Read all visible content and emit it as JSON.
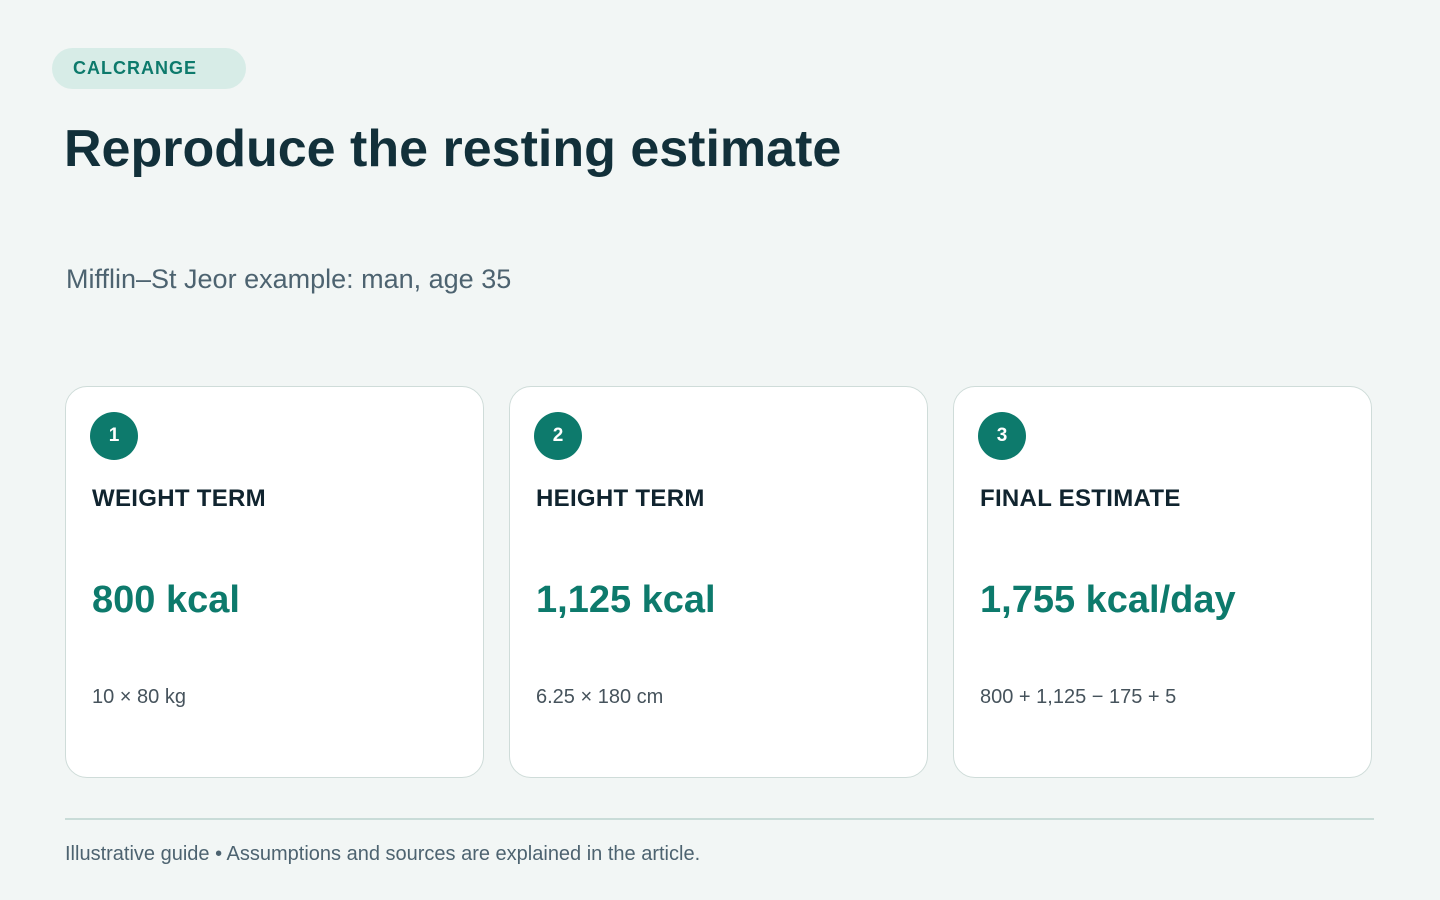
{
  "brand": {
    "label": "CALCRANGE"
  },
  "header": {
    "title": "Reproduce the resting estimate",
    "subtitle": "Mifflin–St Jeor example: man, age 35"
  },
  "cards": [
    {
      "step": "1",
      "label": "WEIGHT TERM",
      "value": "800 kcal",
      "formula": "10 × 80 kg"
    },
    {
      "step": "2",
      "label": "HEIGHT TERM",
      "value": "1,125 kcal",
      "formula": "6.25 × 180 cm"
    },
    {
      "step": "3",
      "label": "FINAL ESTIMATE",
      "value": "1,755 kcal/day",
      "formula": "800 + 1,125 − 175 + 5"
    }
  ],
  "footer": {
    "note": "Illustrative guide • Assumptions and sources are explained in the article."
  },
  "colors": {
    "accent": "#0d7a6c",
    "background": "#f2f6f5",
    "pill_background": "#d7ece7",
    "card_border": "#cfdcd9"
  }
}
